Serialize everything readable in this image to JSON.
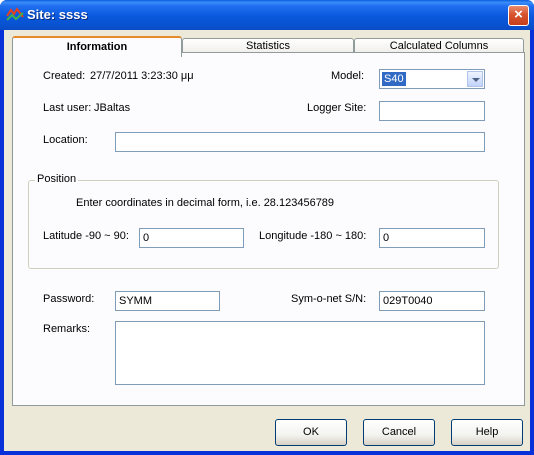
{
  "window": {
    "title": "Site: ssss",
    "close_label": "×"
  },
  "tabs": [
    {
      "label": "Information",
      "active": true
    },
    {
      "label": "Statistics",
      "active": false
    },
    {
      "label": "Calculated Columns",
      "active": false
    }
  ],
  "info": {
    "created_label": "Created:",
    "created_value": "27/7/2011 3:23:30 μμ",
    "last_user_label": "Last user:",
    "last_user_value": "JBaltas",
    "model_label": "Model:",
    "model_value": "S40",
    "logger_site_label": "Logger Site:",
    "logger_site_value": "",
    "location_label": "Location:",
    "location_value": ""
  },
  "position": {
    "group_label": "Position",
    "hint": "Enter coordinates in decimal form, i.e. 28.123456789",
    "latitude_label": "Latitude -90 ~ 90:",
    "latitude_value": "0",
    "longitude_label": "Longitude -180 ~ 180:",
    "longitude_value": "0"
  },
  "security": {
    "password_label": "Password:",
    "password_value": "SYMM",
    "serial_label": "Sym-o-net S/N:",
    "serial_value": "029T0040",
    "remarks_label": "Remarks:",
    "remarks_value": ""
  },
  "buttons": {
    "ok": "OK",
    "cancel": "Cancel",
    "help": "Help"
  },
  "colors": {
    "title_bar": "#0a58dc",
    "dialog_bg": "#ece9d8",
    "selection": "#316ac5",
    "close": "#d8532e"
  }
}
